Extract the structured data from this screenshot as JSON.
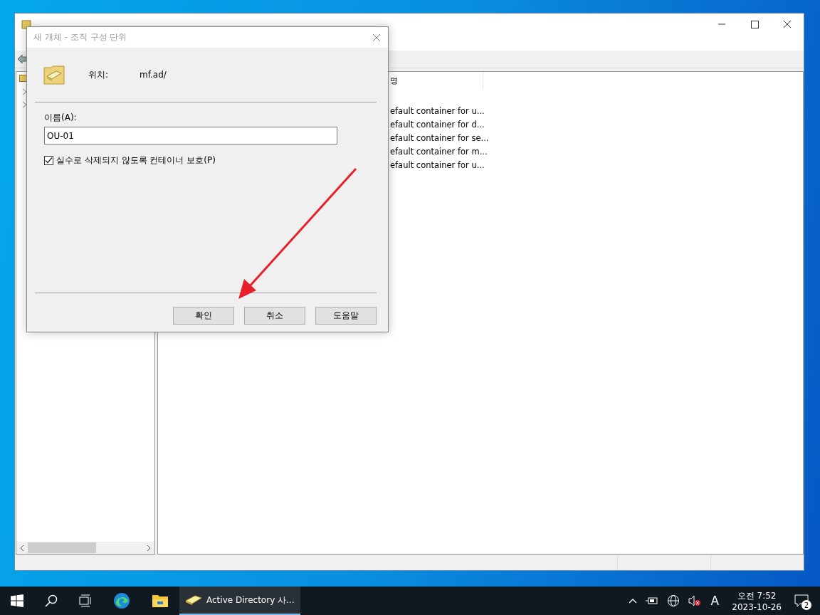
{
  "details": {
    "columns": [
      "명"
    ],
    "rows": [
      {
        "description": "efault container for u..."
      },
      {
        "description": "efault container for d..."
      },
      {
        "description": "efault container for se..."
      },
      {
        "description": "efault container for m..."
      },
      {
        "description": "efault container for u..."
      }
    ]
  },
  "dialog": {
    "title": "새 개체 - 조직 구성 단위",
    "location_label": "위치:",
    "location_value": "mf.ad/",
    "name_label": "이름(A):",
    "name_value": "OU-01",
    "protect": {
      "label": "실수로 삭제되지 않도록 컨테이너 보호(P)",
      "checked": true
    },
    "buttons": [
      {
        "label": "확인"
      },
      {
        "label": "취소"
      },
      {
        "label": "도움말"
      }
    ]
  },
  "taskbar": {
    "app": {
      "label": "Active Directory 사...",
      "active": true
    },
    "input_indicator": "A",
    "time": "오전 7:52",
    "date": "2023-10-26",
    "notification_count": "2"
  }
}
